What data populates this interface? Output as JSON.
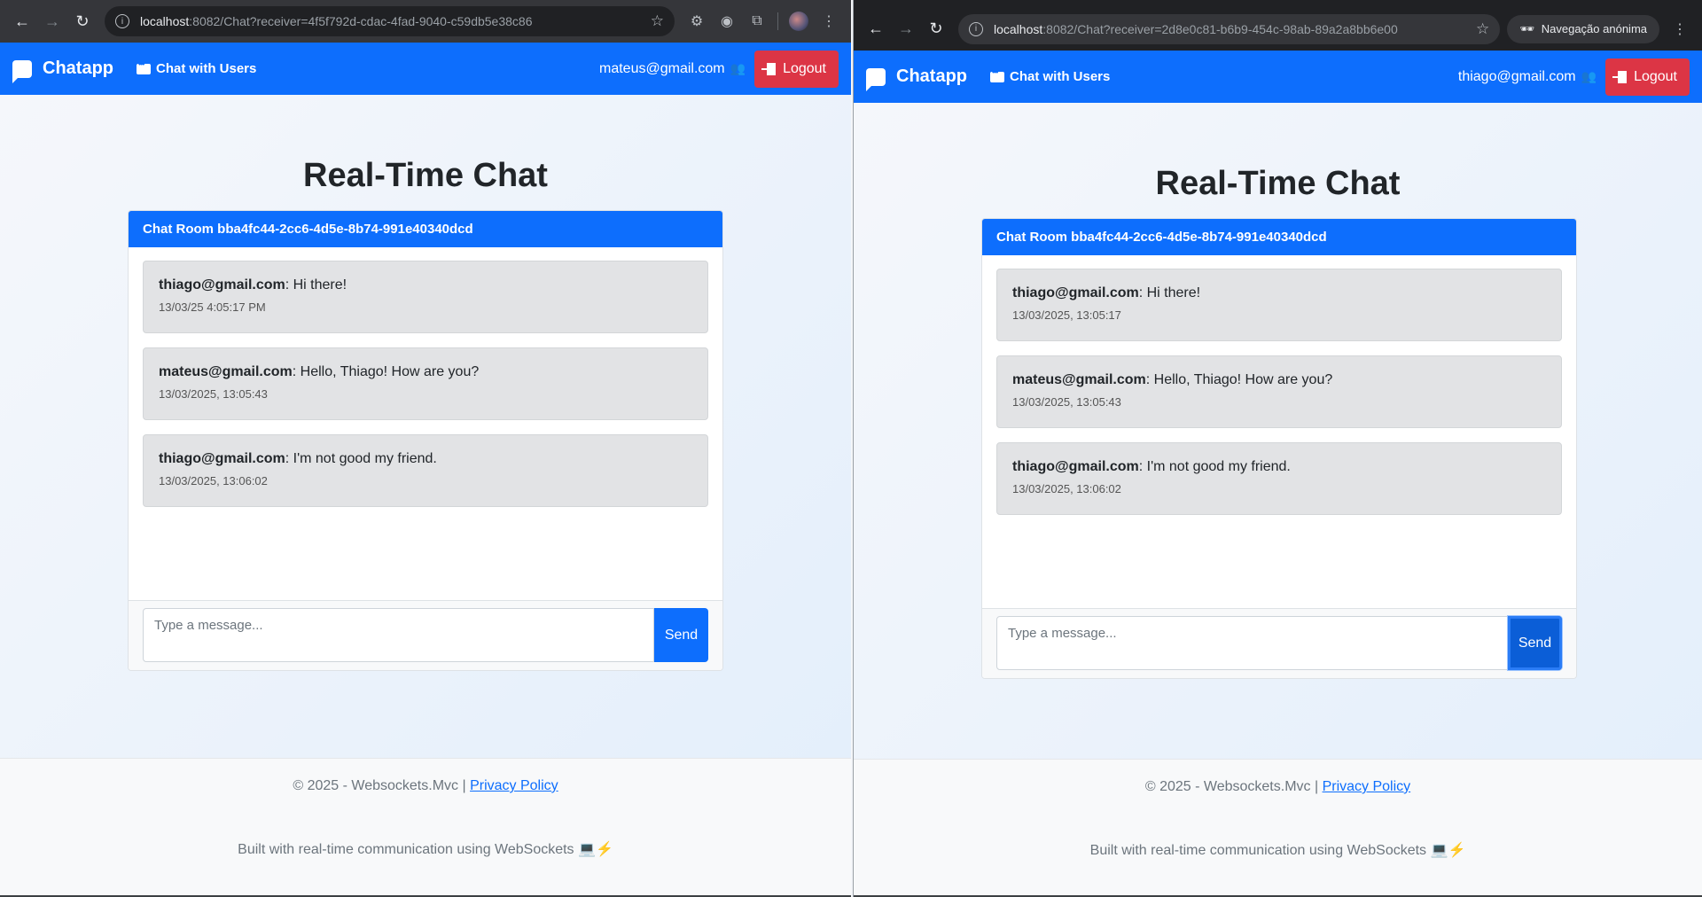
{
  "windows": [
    {
      "url_host": "localhost",
      "url_path": ":8082/Chat?receiver=4f5f792d-cdac-4fad-9040-c59db5e38c86",
      "incognito_label": "",
      "brand": "Chatapp",
      "nav_link": "Chat with Users",
      "user_email": "mateus@gmail.com",
      "logout_label": "Logout",
      "page_title": "Real-Time Chat",
      "room_header": "Chat Room bba4fc44-2cc6-4d5e-8b74-991e40340dcd",
      "messages": [
        {
          "sender": "thiago@gmail.com",
          "text": ": Hi there!",
          "time": "13/03/25 4:05:17 PM"
        },
        {
          "sender": "mateus@gmail.com",
          "text": ": Hello, Thiago! How are you?",
          "time": "13/03/2025, 13:05:43"
        },
        {
          "sender": "thiago@gmail.com",
          "text": ": I'm not good my friend.",
          "time": "13/03/2025, 13:06:02"
        }
      ],
      "input_placeholder": "Type a message...",
      "send_label": "Send",
      "footer_copy": "© 2025 - Websockets.Mvc | ",
      "privacy_label": "Privacy Policy",
      "footer_built": "Built with real-time communication using WebSockets"
    },
    {
      "url_host": "localhost",
      "url_path": ":8082/Chat?receiver=2d8e0c81-b6b9-454c-98ab-89a2a8bb6e00",
      "incognito_label": "Navegação anónima",
      "brand": "Chatapp",
      "nav_link": "Chat with Users",
      "user_email": "thiago@gmail.com",
      "logout_label": "Logout",
      "page_title": "Real-Time Chat",
      "room_header": "Chat Room bba4fc44-2cc6-4d5e-8b74-991e40340dcd",
      "messages": [
        {
          "sender": "thiago@gmail.com",
          "text": ": Hi there!",
          "time": "13/03/2025, 13:05:17"
        },
        {
          "sender": "mateus@gmail.com",
          "text": ": Hello, Thiago! How are you?",
          "time": "13/03/2025, 13:05:43"
        },
        {
          "sender": "thiago@gmail.com",
          "text": ": I'm not good my friend.",
          "time": "13/03/2025, 13:06:02"
        }
      ],
      "input_placeholder": "Type a message...",
      "send_label": "Send",
      "footer_copy": "© 2025 - Websockets.Mvc | ",
      "privacy_label": "Privacy Policy",
      "footer_built": "Built with real-time communication using WebSockets"
    }
  ],
  "colors": {
    "primary": "#0d6efd",
    "danger": "#dc3545",
    "message_bg": "#e2e3e5"
  }
}
